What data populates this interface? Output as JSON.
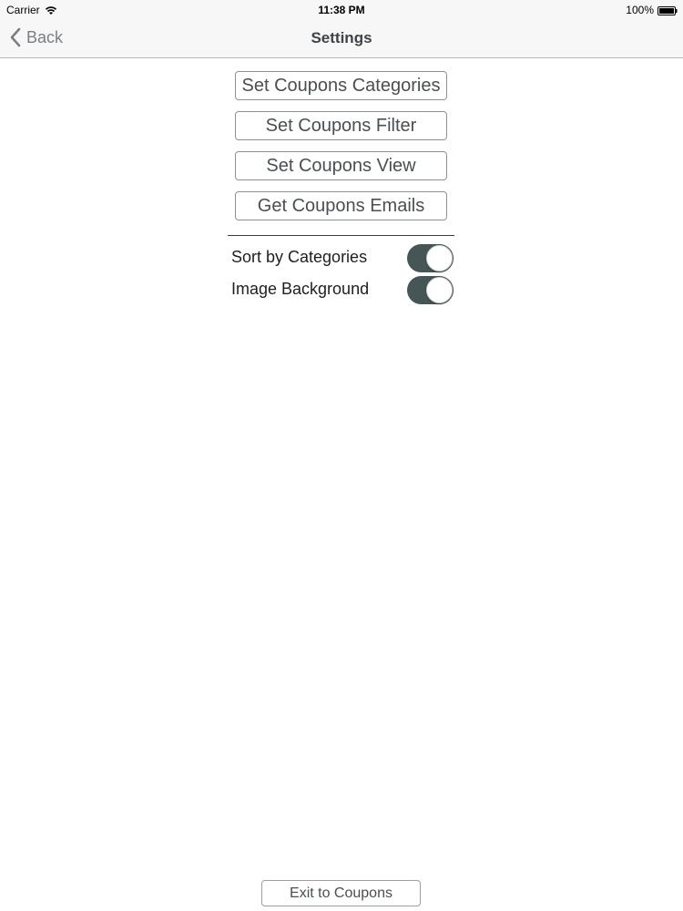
{
  "status_bar": {
    "carrier": "Carrier",
    "time": "11:38 PM",
    "battery": "100%",
    "wifi_icon": "wifi-icon",
    "battery_icon": "battery-icon"
  },
  "nav": {
    "back_label": "Back",
    "back_icon": "chevron-left-icon",
    "title": "Settings"
  },
  "buttons": [
    {
      "label": "Set Coupons Categories"
    },
    {
      "label": "Set Coupons Filter"
    },
    {
      "label": "Set Coupons View"
    },
    {
      "label": "Get Coupons Emails"
    }
  ],
  "settings": [
    {
      "label": "Sort by Categories",
      "on": true
    },
    {
      "label": "Image Background",
      "on": true
    }
  ],
  "footer": {
    "exit_label": "Exit to Coupons"
  },
  "colors": {
    "toggle_on": "#465556",
    "button_text": "#4a4f52",
    "nav_background": "#f7f7f8"
  }
}
